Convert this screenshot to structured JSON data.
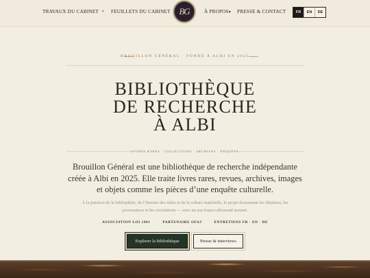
{
  "nav": {
    "left": [
      "Travaux du cabinet",
      "Feuillets du cabinet"
    ],
    "right": [
      "À propos",
      "Presse & contact"
    ],
    "about_chevron": "▾",
    "logo_text": "BG"
  },
  "languages": [
    {
      "code": "FR",
      "active": true
    },
    {
      "code": "EN",
      "active": false
    },
    {
      "code": "DE",
      "active": false
    }
  ],
  "hero": {
    "eyebrow": "Brouillon Général · Fondé à Albi en 2025",
    "title_lines": [
      "Bibliothèque",
      "de recherche",
      "à Albi"
    ],
    "tags": "Livres rares · Collections · Archives · Enquête",
    "lead": "Brouillon Général est une bibliothèque de recherche indépendante créée à Albi en 2025. Elle traite livres rares, revues, archives, images et objets comme les pièces d’une enquête culturelle.",
    "subtext": "À la jonction de la bibliophilie, de l’histoire des idées et de la culture matérielle, le projet documente les filiations, les provenances et les circulations — avec un axe franco-allemand assumé.",
    "badges": [
      "Association loi 1901",
      "Partenaire OFAJ",
      "Entretiens FR · EN · DE"
    ],
    "primary_button": "Explorer la bibliothèque",
    "secondary_button": "Presse & interviews"
  }
}
